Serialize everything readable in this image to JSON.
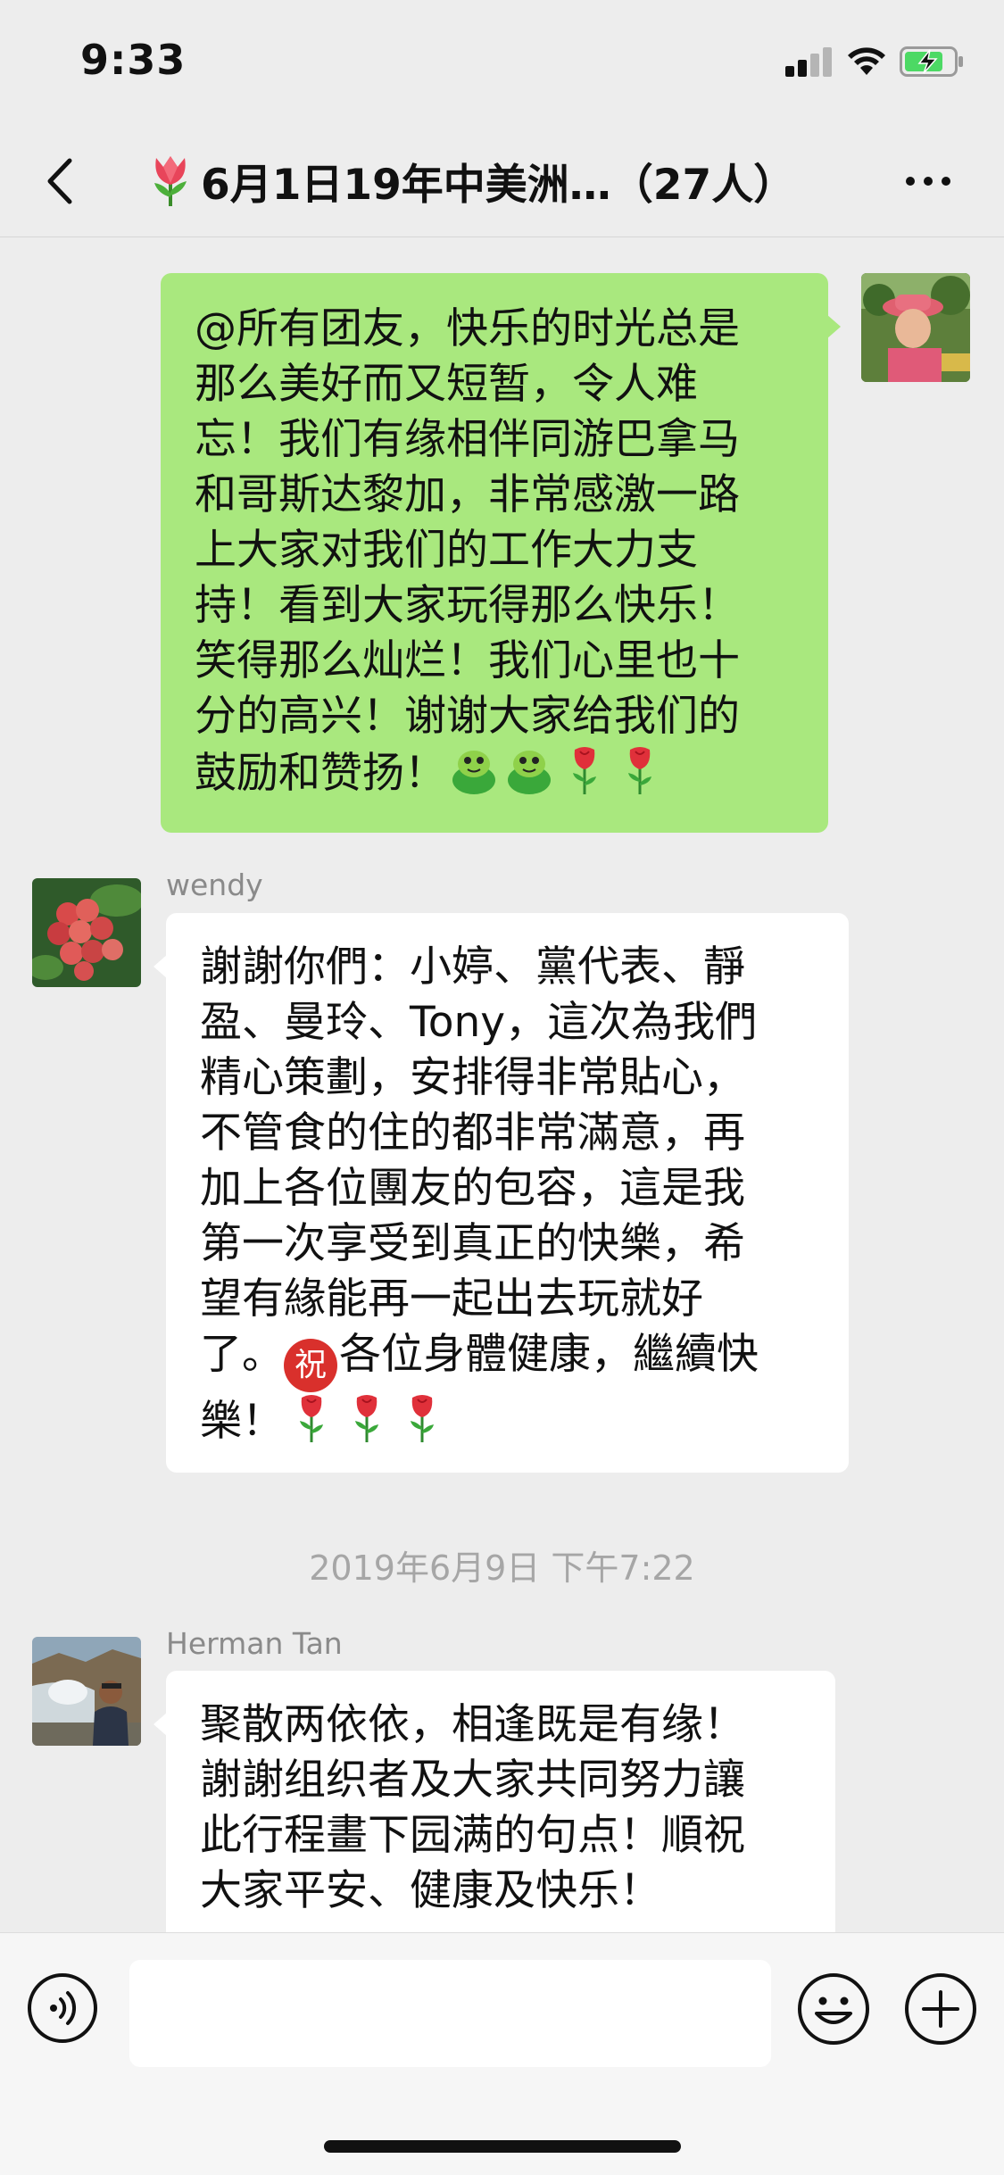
{
  "status_bar": {
    "time": "9:33"
  },
  "header": {
    "title": "6月1日19年中美洲…（27人）",
    "title_icon": "tulip-icon"
  },
  "messages": [
    {
      "sender": "",
      "side": "right",
      "lines": [
        "@所有团友，快乐的时光总是",
        "那么美好而又短暂，令人难",
        "忘！我们有缘相伴同游巴拿马",
        "和哥斯达黎加，非常感激一路",
        "上大家对我们的工作大力支",
        "持！看到大家玩得那么快乐！",
        "笑得那么灿烂！我们心里也十",
        "分的高兴！谢谢大家给我们的",
        "鼓励和赞扬！"
      ],
      "trailing_emojis": [
        "frog-emoji",
        "frog-emoji",
        "rose-emoji",
        "rose-emoji"
      ]
    },
    {
      "sender": "wendy",
      "side": "left",
      "lines": [
        "謝謝你們：小婷、黨代表、靜",
        "盈、曼玲、Tony，這次為我們",
        "精心策劃，安排得非常貼心，",
        "不管食的住的都非常滿意，再",
        "加上各位團友的包容，這是我",
        "第一次享受到真正的快樂，希",
        "望有緣能再一起出去玩就好"
      ],
      "line8_prefix": "了。",
      "zhu_badge": "祝",
      "line8_suffix": "各位身體健康，繼續快",
      "last_line": "樂！",
      "trailing_emojis": [
        "rose-emoji",
        "rose-emoji",
        "rose-emoji"
      ]
    },
    {
      "timestamp": "2019年6月9日 下午7:22"
    },
    {
      "sender": "Herman Tan",
      "side": "left",
      "lines": [
        "聚散两依依，相逢既是有缘！",
        "謝謝组织者及大家共同努力讓",
        "此行程畫下园满的句点！順祝",
        "大家平安、健康及快乐！"
      ]
    }
  ],
  "input_bar": {
    "text_value": ""
  },
  "colors": {
    "background": "#ededed",
    "my_bubble": "#a9e87e",
    "other_bubble": "#ffffff"
  }
}
